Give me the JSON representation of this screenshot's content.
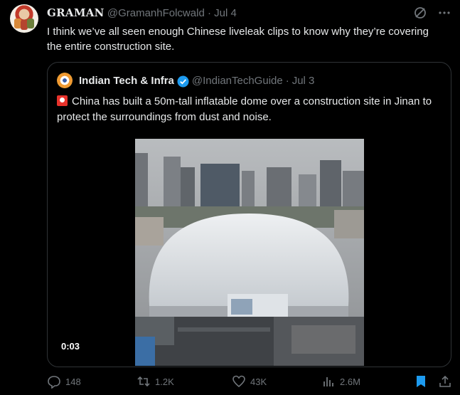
{
  "tweet": {
    "author_name": "GRAMAN",
    "author_handle": "@GramanhFolcwald",
    "separator": "·",
    "date": "Jul 4",
    "text": "I think we’ve all seen enough Chinese liveleak clips to know why they’re covering the entire construction site."
  },
  "quote": {
    "author_name": "Indian Tech & Infra",
    "author_handle": "@IndianTechGuide",
    "separator": "·",
    "date": "Jul 3",
    "text": "China has built a 50m-tall inflatable dome over a construction site in Jinan to protect the surroundings from dust and noise.",
    "video_time": "0:03"
  },
  "actions": {
    "replies": "148",
    "reposts": "1.2K",
    "likes": "43K",
    "views": "2.6M"
  },
  "colors": {
    "background": "#000000",
    "text": "#e7e9ea",
    "muted": "#71767b",
    "accent": "#1d9bf0",
    "border": "#2f3336"
  },
  "icons": [
    "grok-icon",
    "more-icon",
    "verified-icon",
    "siren-icon",
    "reply-icon",
    "repost-icon",
    "like-icon",
    "views-icon",
    "bookmark-icon",
    "share-icon"
  ]
}
